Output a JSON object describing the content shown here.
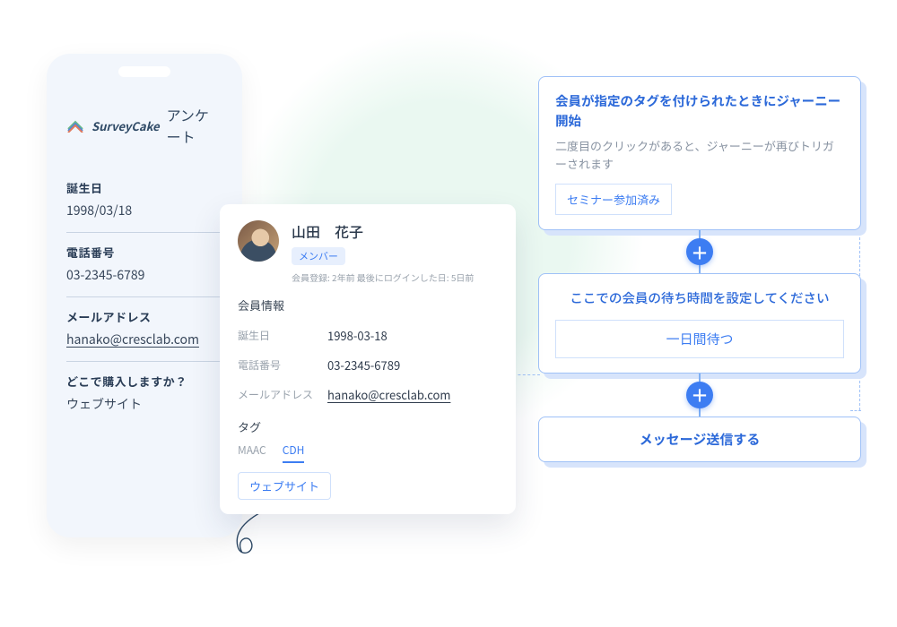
{
  "brand": {
    "name": "SurveyCake",
    "survey_label": "アンケート"
  },
  "form": {
    "fields": [
      {
        "label": "誕生日",
        "value": "1998/03/18",
        "underline": false
      },
      {
        "label": "電話番号",
        "value": "03-2345-6789",
        "underline": false
      },
      {
        "label": "メールアドレス",
        "value": "hanako@cresclab.com",
        "underline": true
      },
      {
        "label": "どこで購入しますか？",
        "value": "ウェブサイト",
        "underline": false
      }
    ]
  },
  "profile": {
    "name": "山田　花子",
    "role_badge": "メンバー",
    "meta": "会員登録: 2年前  最後にログインした日: 5日前",
    "section_title": "会員情報",
    "rows": [
      {
        "k": "誕生日",
        "v": "1998-03-18"
      },
      {
        "k": "電話番号",
        "v": "03-2345-6789"
      },
      {
        "k": "メールアドレス",
        "v": "hanako@cresclab.com",
        "link": true
      }
    ],
    "tags_label": "タグ",
    "tabs": [
      {
        "label": "MAAC",
        "active": false
      },
      {
        "label": "CDH",
        "active": true
      }
    ],
    "chip": "ウェブサイト"
  },
  "flow": {
    "node1": {
      "title": "会員が指定のタグを付けられたときにジャーニー開始",
      "desc": "二度目のクリックがあると、ジャーニーが再びトリガーされます",
      "tag": "セミナー参加済み"
    },
    "node2": {
      "title": "ここでの会員の待ち時間を設定してください",
      "option": "一日間待つ"
    },
    "node3": {
      "label": "メッセージ送信する"
    }
  }
}
